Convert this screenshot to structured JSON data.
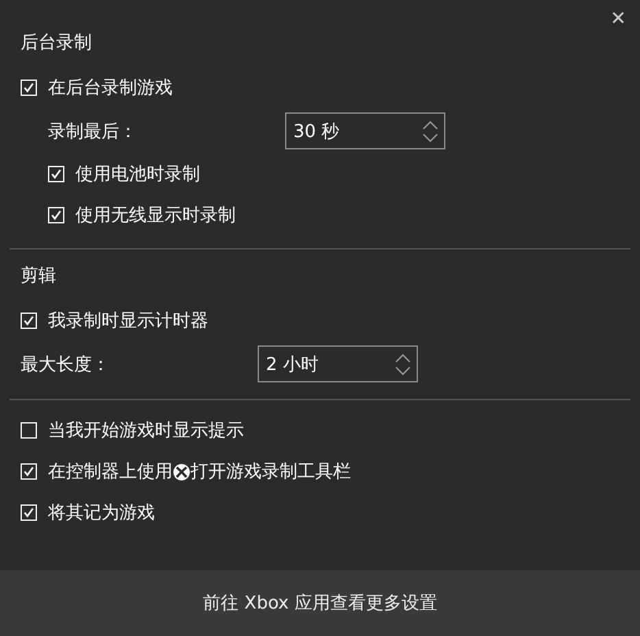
{
  "close_label": "✕",
  "sections": [
    {
      "title": "后台录制",
      "items": [
        {
          "kind": "checkbox",
          "label": "在后台录制游戏",
          "checked": true,
          "indent": false
        },
        {
          "kind": "spinner",
          "label": "录制最后：",
          "value": "30 秒",
          "indent": true
        },
        {
          "kind": "checkbox",
          "label": "使用电池时录制",
          "checked": true,
          "indent": true
        },
        {
          "kind": "checkbox",
          "label": "使用无线显示时录制",
          "checked": true,
          "indent": true
        }
      ]
    },
    {
      "title": "剪辑",
      "items": [
        {
          "kind": "checkbox",
          "label": "我录制时显示计时器",
          "checked": true,
          "indent": false
        },
        {
          "kind": "spinner",
          "label": "最大长度：",
          "value": "2 小时",
          "indent": false
        }
      ]
    },
    {
      "items": [
        {
          "kind": "checkbox",
          "label": "当我开始游戏时显示提示",
          "checked": false,
          "indent": false
        },
        {
          "kind": "checkbox",
          "label": "在控制器上使用",
          "label_after": "打开游戏录制工具栏",
          "checked": true,
          "indent": false
        },
        {
          "kind": "checkbox",
          "label": "将其记为游戏",
          "checked": true,
          "indent": false
        }
      ]
    }
  ],
  "footer_link": "前往 Xbox 应用查看更多设置"
}
